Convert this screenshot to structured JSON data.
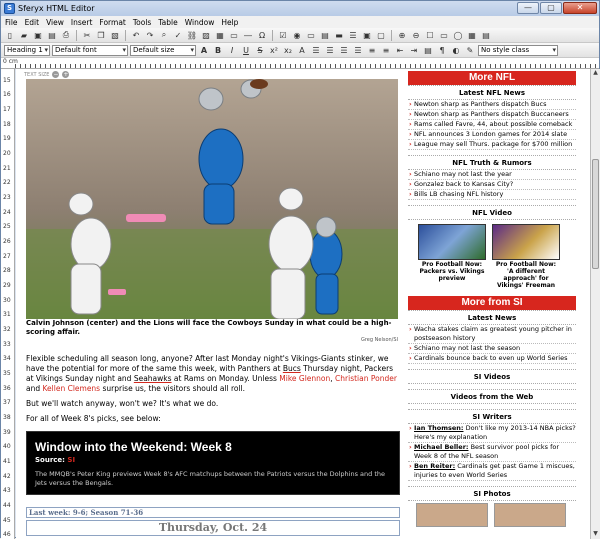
{
  "window": {
    "title": "Sferyx HTML Editor",
    "icon_label": "S",
    "controls": [
      "—",
      "▢",
      "✕"
    ]
  },
  "menu": [
    "File",
    "Edit",
    "View",
    "Insert",
    "Format",
    "Tools",
    "Table",
    "Window",
    "Help"
  ],
  "toolbar2": {
    "paragraph_style": "Heading 1",
    "font": "Default font",
    "size": "Default size",
    "class_style": "No style class"
  },
  "ruler": {
    "unit": "0 cm",
    "vertical_numbers": [
      "15",
      "16",
      "17",
      "18",
      "19",
      "20",
      "21",
      "22",
      "23",
      "24",
      "25",
      "26",
      "27",
      "28",
      "29",
      "30",
      "31",
      "32",
      "33",
      "34",
      "35",
      "36",
      "37",
      "38",
      "39",
      "40",
      "41",
      "42",
      "43",
      "44",
      "45",
      "46"
    ]
  },
  "article": {
    "text_size_label": "TEXT SIZE",
    "photo_credit": "Greg Nelson/SI",
    "caption": "Calvin Johnson (center) and the Lions will face the Cowboys Sunday in what could be a high-scoring affair.",
    "p1_a": "Flexible scheduling all season long, anyone? After last Monday night's Vikings-Giants stinker, we have the potential for more of the same this week, with Panthers at ",
    "p1_bucs": "Bucs",
    "p1_b": " Thursday night, Packers at Vikings Sunday night and ",
    "p1_seahawks": "Seahawks",
    "p1_c": " at Rams on Monday. Unless ",
    "p1_mike": "Mike Glennon",
    "p1_comma": ", ",
    "p1_christian": "Christian Ponder",
    "p1_and": " and ",
    "p1_kellen": "Kellen Clemens",
    "p1_d": " surprise us, the visitors should all roll.",
    "p2": "But we'll watch anyway, won't we? It's what we do.",
    "p3": "For all of Week 8's picks, see below:",
    "weekend_title": "Window into the Weekend: Week 8",
    "weekend_source_label": "Source: ",
    "weekend_source": "SI",
    "weekend_desc": "The MMQB's Peter King previews Week 8's AFC matchups between the Patriots versus the Dolphins and the Jets versus the Bengals.",
    "record": "Last week: 9-6; Season 71-36",
    "day": "Thursday, Oct. 24"
  },
  "sidebar": {
    "more_nfl": "More NFL",
    "latest_nfl_news": "Latest NFL News",
    "nfl_news": [
      "Newton sharp as Panthers dispatch Bucs",
      "Newton sharp as Panthers dispatch Buccaneers",
      "Rams called Favre, 44, about possible comeback",
      "NFL announces 3 London games for 2014 slate",
      "League may sell Thurs. package for $700 million"
    ],
    "truth_rumors": "NFL Truth & Rumors",
    "rumors": [
      "Schiano may not last the year",
      "Gonzalez back to Kansas City?",
      "Bills LB chasing NFL history"
    ],
    "nfl_video": "NFL Video",
    "videos": [
      "Pro Football Now: Packers vs. Vikings preview",
      "Pro Football Now: 'A different approach' for Vikings' Freeman"
    ],
    "more_si": "More from SI",
    "latest_news": "Latest News",
    "news": [
      "Wacha stakes claim as greatest young pitcher in postseason history",
      "Schiano may not last the season",
      "Cardinals bounce back to even up World Series"
    ],
    "si_videos": "SI Videos",
    "videos_web": "Videos from the Web",
    "si_writers": "SI Writers",
    "writers": [
      {
        "name": "Ian Thomsen:",
        "text": " Don't like my 2013-14 NBA picks? Here's my explanation"
      },
      {
        "name": "Michael Beller:",
        "text": " Best survivor pool picks for Week 8 of the NFL season"
      },
      {
        "name": "Ben Reiter:",
        "text": " Cardinals get past Game 1 miscues, injuries to even World Series"
      }
    ],
    "si_photos": "SI Photos"
  }
}
